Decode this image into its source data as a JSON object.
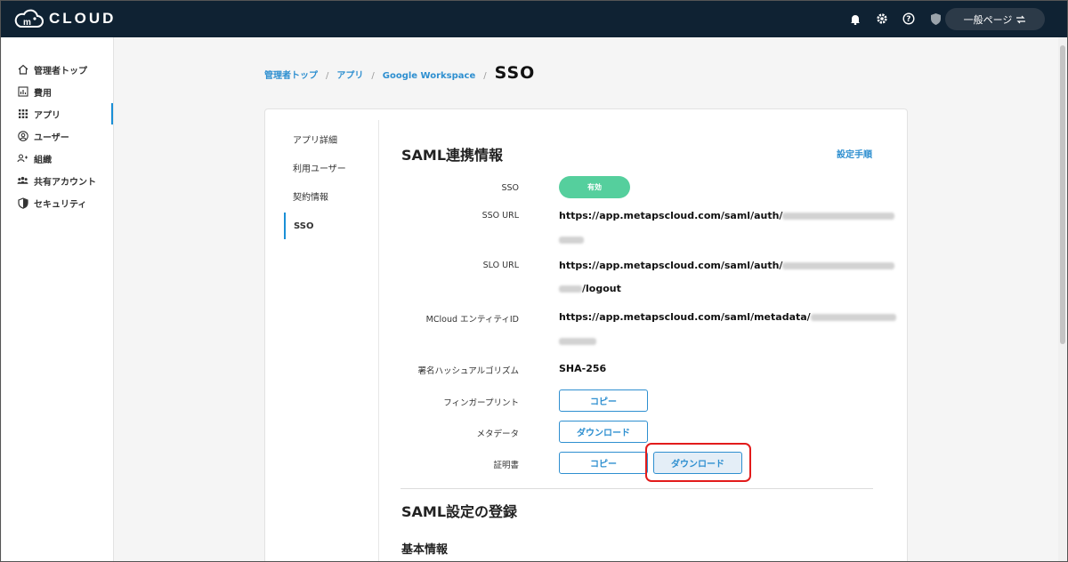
{
  "header": {
    "logo_text": "CLOUD",
    "icons": [
      "bell-icon",
      "gear-icon",
      "help-icon",
      "shield-icon"
    ],
    "user_pill_label": "一般ページ"
  },
  "sidebar": {
    "items": [
      {
        "label": "管理者トップ",
        "icon": "home-icon"
      },
      {
        "label": "費用",
        "icon": "chart-icon"
      },
      {
        "label": "アプリ",
        "icon": "apps-grid-icon",
        "active": true
      },
      {
        "label": "ユーザー",
        "icon": "user-icon"
      },
      {
        "label": "組織",
        "icon": "group-icon"
      },
      {
        "label": "共有アカウント",
        "icon": "shared-users-icon"
      },
      {
        "label": "セキュリティ",
        "icon": "shield-icon"
      }
    ]
  },
  "breadcrumb": {
    "items": [
      "管理者トップ",
      "アプリ",
      "Google Workspace"
    ],
    "separator": "/",
    "current": "SSO"
  },
  "tabs": [
    {
      "label": "アプリ詳細"
    },
    {
      "label": "利用ユーザー"
    },
    {
      "label": "契約情報"
    },
    {
      "label": "SSO",
      "active": true
    }
  ],
  "saml_info": {
    "title": "SAML連携情報",
    "help_link": "設定手順",
    "sso_label": "SSO",
    "sso_status": "有効",
    "sso_url_label": "SSO URL",
    "sso_url": "https://app.metapscloud.com/saml/auth/",
    "slo_url_label": "SLO URL",
    "slo_url": "https://app.metapscloud.com/saml/auth/",
    "slo_url_suffix": "/logout",
    "entity_label": "MCloud エンティティID",
    "entity_id": "https://app.metapscloud.com/saml/metadata/",
    "hash_label": "署名ハッシュアルゴリズム",
    "hash_value": "SHA-256",
    "fingerprint_label": "フィンガープリント",
    "fingerprint_button": "コピー",
    "metadata_label": "メタデータ",
    "metadata_button": "ダウンロード",
    "cert_label": "証明書",
    "cert_copy_button": "コピー",
    "cert_download_button": "ダウンロード"
  },
  "saml_settings": {
    "title": "SAML設定の登録",
    "subtitle": "基本情報"
  },
  "colors": {
    "topbar": "#0f2233",
    "accent": "#2e8fd0",
    "enabled": "#55cf9d",
    "highlight": "#e21b1b"
  }
}
